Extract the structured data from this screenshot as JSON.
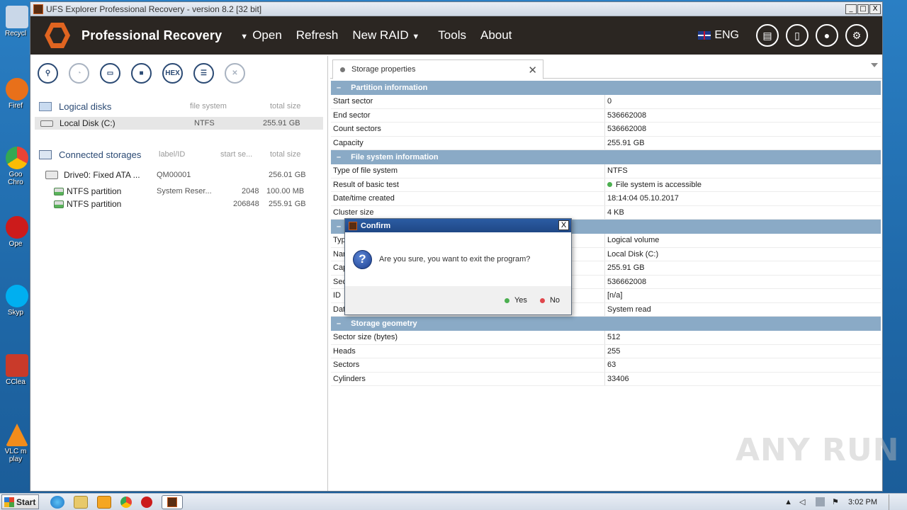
{
  "desktop": {
    "icons": [
      {
        "label": "Recycl",
        "color": "#c9d7e8"
      },
      {
        "label": "Firef",
        "color": "#e8701a"
      },
      {
        "label": "Goo\nChro",
        "color": "#34a853"
      },
      {
        "label": "Ope",
        "color": "#cc1b1b"
      },
      {
        "label": "Skyp",
        "color": "#00aff0"
      },
      {
        "label": "CClea",
        "color": "#c93a2a"
      },
      {
        "label": "VLC m\nplay",
        "color": "#f28c1b"
      }
    ]
  },
  "window": {
    "title": "UFS Explorer Professional Recovery - version 8.2 [32 bit]",
    "controls": {
      "minimize": "_",
      "maximize": "□",
      "close": "X"
    }
  },
  "appbar": {
    "brand": "Professional Recovery",
    "menu": {
      "open": "Open",
      "refresh": "Refresh",
      "new_raid": "New RAID",
      "tools": "Tools",
      "about": "About"
    },
    "language": "ENG"
  },
  "left": {
    "toolbar": {
      "hex_label": "HEX"
    },
    "logical": {
      "title": "Logical disks",
      "col_fs": "file system",
      "col_size": "total size",
      "rows": [
        {
          "name": "Local Disk (C:)",
          "fs": "NTFS",
          "size": "255.91 GB"
        }
      ]
    },
    "storages": {
      "title": "Connected storages",
      "col_label": "label/ID",
      "col_start": "start se...",
      "col_size": "total size",
      "drive": {
        "name": "Drive0: Fixed ATA ...",
        "label": "QM00001",
        "size": "256.01 GB"
      },
      "partitions": [
        {
          "name": "NTFS partition",
          "label": "System Reser...",
          "start": "2048",
          "size": "100.00 MB"
        },
        {
          "name": "NTFS partition",
          "label": "",
          "start": "206848",
          "size": "255.91 GB"
        }
      ]
    }
  },
  "right": {
    "tab_label": "Storage properties",
    "groups": {
      "partition": {
        "title": "Partition information",
        "rows": [
          {
            "k": "Start sector",
            "v": "0"
          },
          {
            "k": "End sector",
            "v": "536662008"
          },
          {
            "k": "Count sectors",
            "v": "536662008"
          },
          {
            "k": "Capacity",
            "v": "255.91 GB"
          }
        ]
      },
      "fs": {
        "title": "File system information",
        "rows": [
          {
            "k": "Type of file system",
            "v": "NTFS"
          },
          {
            "k": "Result of basic test",
            "v": "File system is accessible"
          },
          {
            "k": "Date/time created",
            "v": "18:14:04 05.10.2017"
          },
          {
            "k": "Cluster size",
            "v": "4 KB"
          }
        ]
      },
      "object": {
        "title": "",
        "rows": [
          {
            "k": "Typ",
            "v": "Logical volume"
          },
          {
            "k": "Nar",
            "v": "Local Disk (C:)"
          },
          {
            "k": "Cap",
            "v": "255.91 GB"
          },
          {
            "k": "Sec",
            "v": "536662008"
          },
          {
            "k": "ID",
            "v": "[n/a]"
          },
          {
            "k": "Dat",
            "v": "System read"
          }
        ]
      },
      "geometry": {
        "title": "Storage geometry",
        "rows": [
          {
            "k": "Sector size (bytes)",
            "v": "512"
          },
          {
            "k": "Heads",
            "v": "255"
          },
          {
            "k": "Sectors",
            "v": "63"
          },
          {
            "k": "Cylinders",
            "v": "33406"
          }
        ]
      }
    }
  },
  "dialog": {
    "title": "Confirm",
    "close": "X",
    "message": "Are you sure, you want to exit the program?",
    "yes": "Yes",
    "no": "No",
    "yes_color": "#4caf50",
    "no_color": "#e0474c"
  },
  "watermark": "ANY RUN",
  "taskbar": {
    "start": "Start",
    "clock": "3:02 PM"
  }
}
